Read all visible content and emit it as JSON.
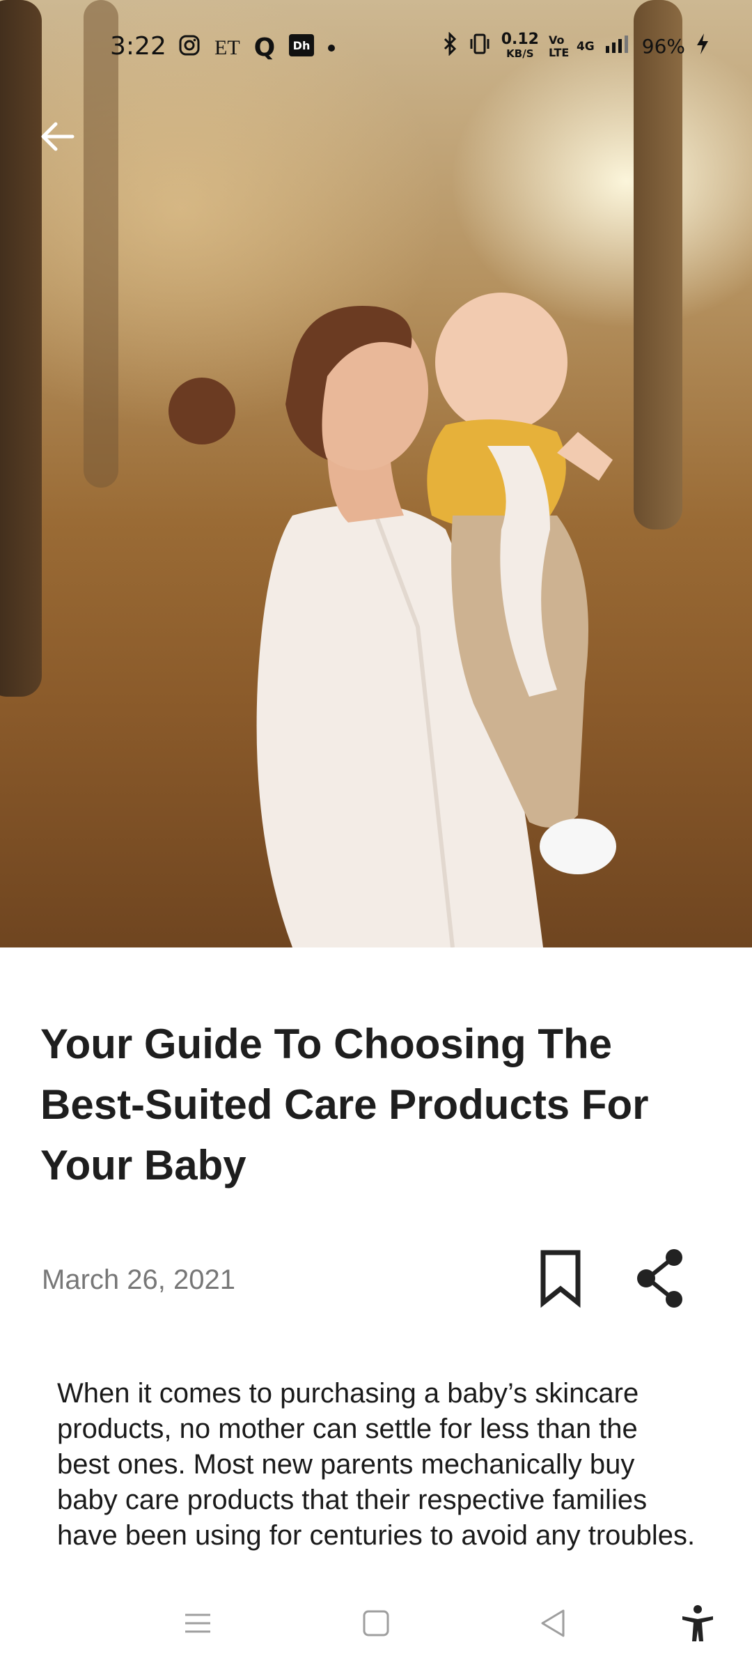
{
  "status_bar": {
    "time": "3:22",
    "app_icons": [
      "instagram-icon",
      "ET",
      "Q",
      "dh-icon"
    ],
    "network_speed": "0.12",
    "network_unit": "KB/S",
    "volte": "Vo LTE",
    "network_type": "4G",
    "battery": "96%"
  },
  "article": {
    "title": "Your Guide To Choosing The Best-Suited Care Products For Your Baby",
    "date": "March 26, 2021",
    "body": "When it comes to purchasing a baby’s skincare products, no mother can settle for less than the best ones. Most new parents mechanically buy baby care products that their respective families have been using for centuries to avoid any troubles."
  },
  "colors": {
    "title": "#1e1e1e",
    "date": "#777777",
    "icon": "#222222",
    "nav_icon": "#9e9e9e"
  }
}
